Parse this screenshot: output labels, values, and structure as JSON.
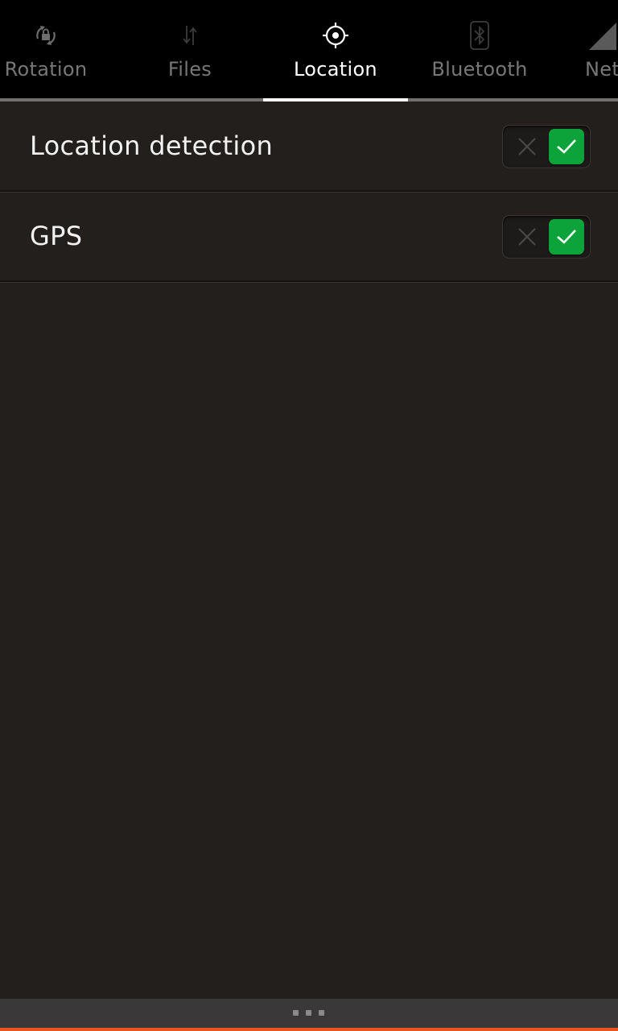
{
  "tabs": [
    {
      "label": "Rotation",
      "icon": "rotation-lock-icon",
      "active": false
    },
    {
      "label": "Files",
      "icon": "transfer-icon",
      "active": false
    },
    {
      "label": "Location",
      "icon": "location-icon",
      "active": true
    },
    {
      "label": "Bluetooth",
      "icon": "bluetooth-icon",
      "active": false
    },
    {
      "label": "Network",
      "icon": "network-signal-icon",
      "active": false
    }
  ],
  "settings": [
    {
      "label": "Location detection",
      "enabled": true
    },
    {
      "label": "GPS",
      "enabled": true
    }
  ],
  "colors": {
    "background": "#221f1d",
    "tab_bar": "#000000",
    "switch_on": "#0da33b",
    "accent": "#e95420"
  }
}
